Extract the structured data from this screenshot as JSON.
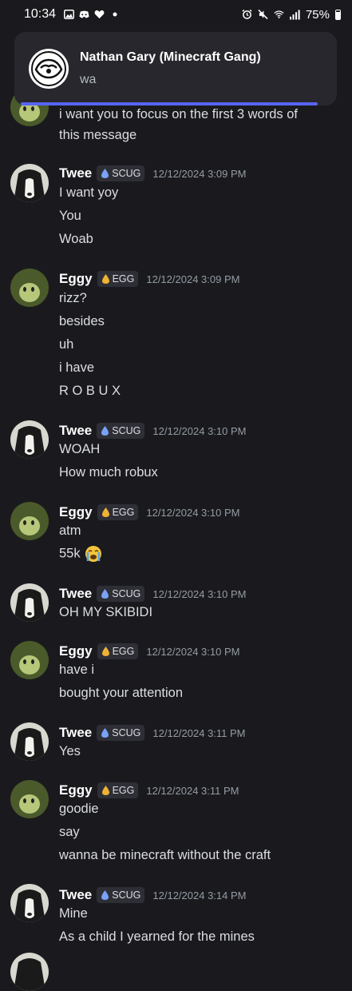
{
  "status_bar": {
    "time": "10:34",
    "battery_text": "75%",
    "left_icons": [
      "gallery-icon",
      "discord-icon",
      "heart-icon",
      "dot-icon"
    ],
    "right_icons": [
      "alarm-icon",
      "mute-icon",
      "wifi-icon",
      "signal-icon",
      "battery-icon"
    ]
  },
  "notification": {
    "title": "Nathan Gary (Minecraft Gang)",
    "body": "wa",
    "progress_fraction": 0.93
  },
  "messages": [
    {
      "author": "",
      "tag": "",
      "time": "",
      "lines": [
        "i want you to focus on the first 3 words of",
        "this message"
      ]
    },
    {
      "author": "Twee",
      "tag": "SCUG",
      "time": "12/12/2024 3:09 PM",
      "lines": [
        "I want yoy",
        "You",
        "Woab"
      ]
    },
    {
      "author": "Eggy",
      "tag": "EGG",
      "time": "12/12/2024 3:09 PM",
      "lines": [
        "rizz?",
        "besides",
        "uh",
        "i have",
        "R O B U X"
      ]
    },
    {
      "author": "Twee",
      "tag": "SCUG",
      "time": "12/12/2024 3:10 PM",
      "lines": [
        "WOAH",
        "How much robux"
      ]
    },
    {
      "author": "Eggy",
      "tag": "EGG",
      "time": "12/12/2024 3:10 PM",
      "lines": [
        "atm",
        "55k"
      ]
    },
    {
      "author": "Twee",
      "tag": "SCUG",
      "time": "12/12/2024 3:10 PM",
      "lines": [
        "OH MY SKIBIDI"
      ]
    },
    {
      "author": "Eggy",
      "tag": "EGG",
      "time": "12/12/2024 3:10 PM",
      "lines": [
        "have i",
        "bought your attention"
      ]
    },
    {
      "author": "Twee",
      "tag": "SCUG",
      "time": "12/12/2024 3:11 PM",
      "lines": [
        "Yes"
      ]
    },
    {
      "author": "Eggy",
      "tag": "EGG",
      "time": "12/12/2024 3:11 PM",
      "lines": [
        "goodie",
        "say",
        "wanna be minecraft without the craft"
      ]
    },
    {
      "author": "Twee",
      "tag": "SCUG",
      "time": "12/12/2024 3:14 PM",
      "lines": [
        "Mine",
        "As a child I yearned for the mines"
      ]
    }
  ],
  "colors": {
    "background": "#1a1a1e",
    "accent": "#5865f2",
    "scug_tag_icon": "#7aa2f7",
    "egg_tag_icon": "#f0b232"
  }
}
